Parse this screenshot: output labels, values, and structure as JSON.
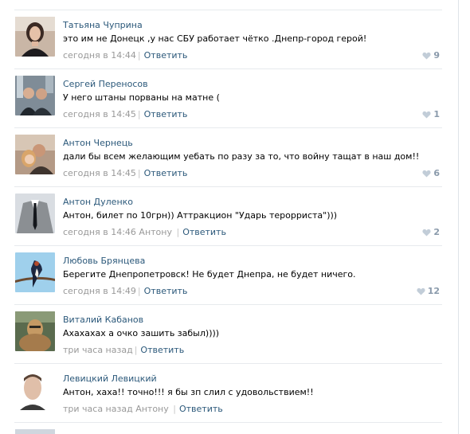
{
  "comments": [
    {
      "author": "Татьяна Чуприна",
      "text": "это им не Донецк ,у нас СБУ работает чётко .Днепр-город герой!",
      "time": "сегодня в 14:44",
      "reply_label": "Ответить",
      "likes": "9",
      "to": ""
    },
    {
      "author": "Сергей Переносов",
      "text": "У него штаны порваны на матне (",
      "time": "сегодня в 14:45",
      "reply_label": "Ответить",
      "likes": "1",
      "to": ""
    },
    {
      "author": "Антон Чернець",
      "text": "дали бы всем желающим уебать по разу за то, что войну тащат в наш дом!!",
      "time": "сегодня в 14:45",
      "reply_label": "Ответить",
      "likes": "6",
      "to": ""
    },
    {
      "author": "Антон Дуленко",
      "text": "Антон, билет по 10грн)) Аттракцион \"Ударь терорриста\")))",
      "time": "сегодня в 14:46",
      "reply_label": "Ответить",
      "likes": "2",
      "to": "Антону"
    },
    {
      "author": "Любовь Брянцева",
      "text": "Берегите Днепропетровск! Не будет Днепра, не будет ничего.",
      "time": "сегодня в 14:49",
      "reply_label": "Ответить",
      "likes": "12",
      "to": ""
    },
    {
      "author": "Виталий Кабанов",
      "text": "Ахахахах а очко зашить забыл))))",
      "time": "три часа назад",
      "reply_label": "Ответить",
      "likes": "",
      "to": ""
    },
    {
      "author": "Левицкий Левицкий",
      "text": "Антон, хаха!! точно!!! я бы зп слил с удовольствием!!",
      "time": "три часа назад",
      "reply_label": "Ответить",
      "likes": "",
      "to": "Антону"
    }
  ],
  "icons": {
    "like": "heart-icon"
  },
  "colors": {
    "author_link": "#2b587a",
    "meta": "#999999",
    "like": "#8a9aab",
    "divider": "#e7eaed"
  }
}
